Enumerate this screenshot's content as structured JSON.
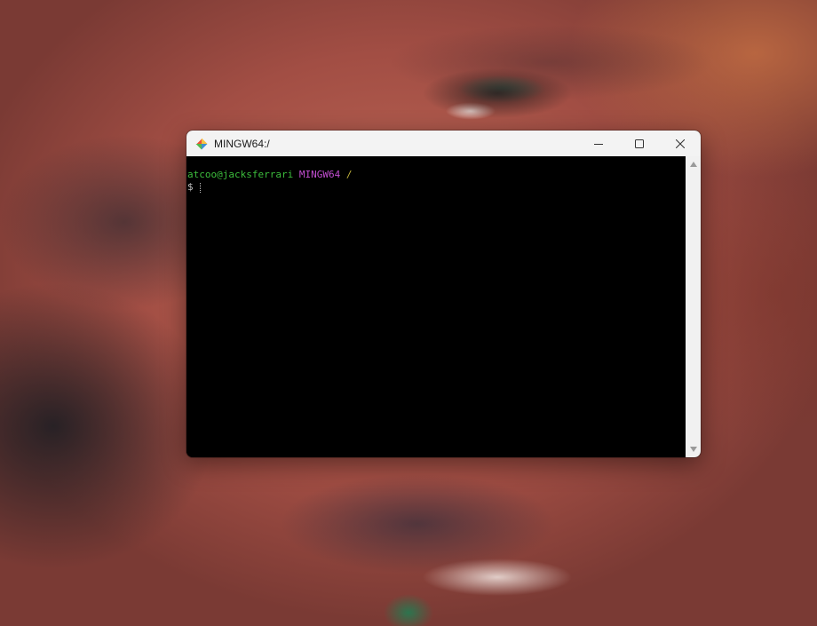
{
  "window": {
    "title": "MINGW64:/"
  },
  "terminal": {
    "user_host": "atcoo@jacksferrari",
    "system": "MINGW64",
    "path": "/",
    "prompt": "$ "
  },
  "icons": {
    "app": "git-logo-icon",
    "minimize": "minimize-icon",
    "maximize": "maximize-icon",
    "close": "close-icon",
    "scroll_up": "scroll-up-arrow-icon",
    "scroll_down": "scroll-down-arrow-icon"
  },
  "colors": {
    "user_host": "#3cbd3c",
    "system": "#c24ed1",
    "path": "#c2b43c",
    "terminal_bg": "#000000",
    "titlebar_bg": "#f3f3f3"
  }
}
